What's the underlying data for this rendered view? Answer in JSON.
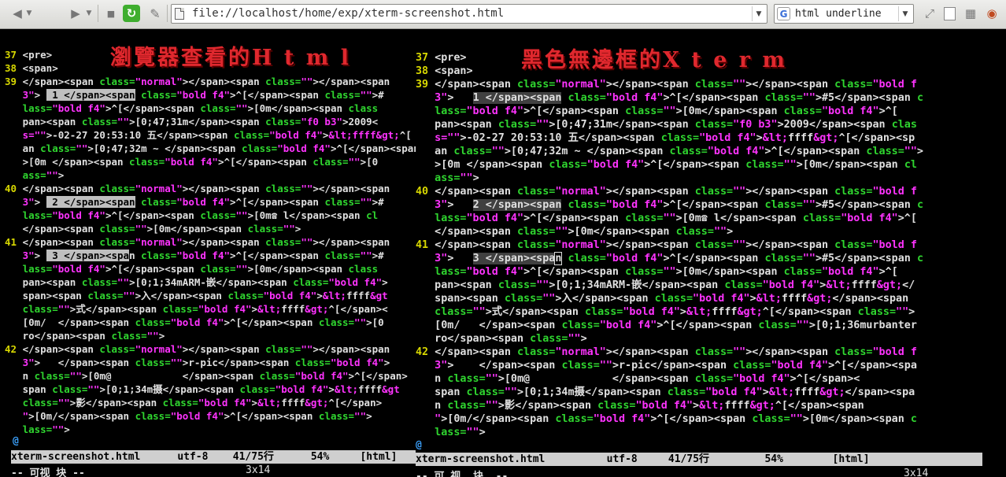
{
  "browser": {
    "url": "file://localhost/home/exp/xterm-screenshot.html",
    "search_text": "html underline",
    "search_engine_icon": "G"
  },
  "left": {
    "title": "瀏覽器查看的H t m l",
    "at": "@",
    "status": "xterm-screenshot.html      utf-8    41/75行      54%     [html]",
    "cmd": "-- 可视 块 --",
    "cmd_right": "3x14"
  },
  "right": {
    "title": "黑色無邊框的X t e r m",
    "at": "@",
    "status": "xterm-screenshot.html          utf-8     41/75行         54%        [html]",
    "cmd": "-- 可 视  块  --",
    "cmd_right": "3x14"
  },
  "colors": {
    "line_number": "#d8d800",
    "tag": "#e0e0e0",
    "attr": "#2fd52f",
    "value": "#ff33ff",
    "title": "#e0282e",
    "status_bg": "#cfcfcf"
  }
}
